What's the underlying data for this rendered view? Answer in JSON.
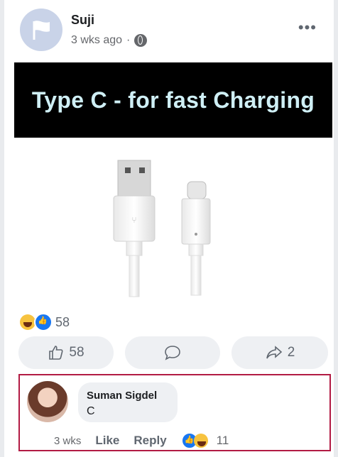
{
  "post": {
    "author": "Suji",
    "time": "3 wks ago",
    "banner_text": "Type C - for fast Charging",
    "more_label": "•••"
  },
  "reactions": {
    "count": "58"
  },
  "actions": {
    "like_count": "58",
    "share_count": "2"
  },
  "comment": {
    "author": "Suman Sigdel",
    "text": "C",
    "time": "3 wks",
    "like_label": "Like",
    "reply_label": "Reply",
    "reaction_count": "11"
  },
  "colors": {
    "accent": "#1877f2",
    "highlight_border": "#b21b44"
  }
}
